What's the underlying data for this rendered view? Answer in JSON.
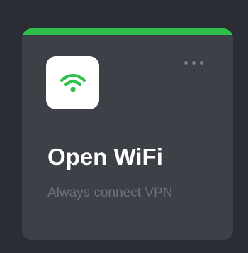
{
  "card": {
    "title": "Open WiFi",
    "subtitle": "Always connect VPN",
    "icon": "wifi-icon",
    "accent_color": "#2fbf4a",
    "menu_icon": "more-horizontal-icon"
  }
}
